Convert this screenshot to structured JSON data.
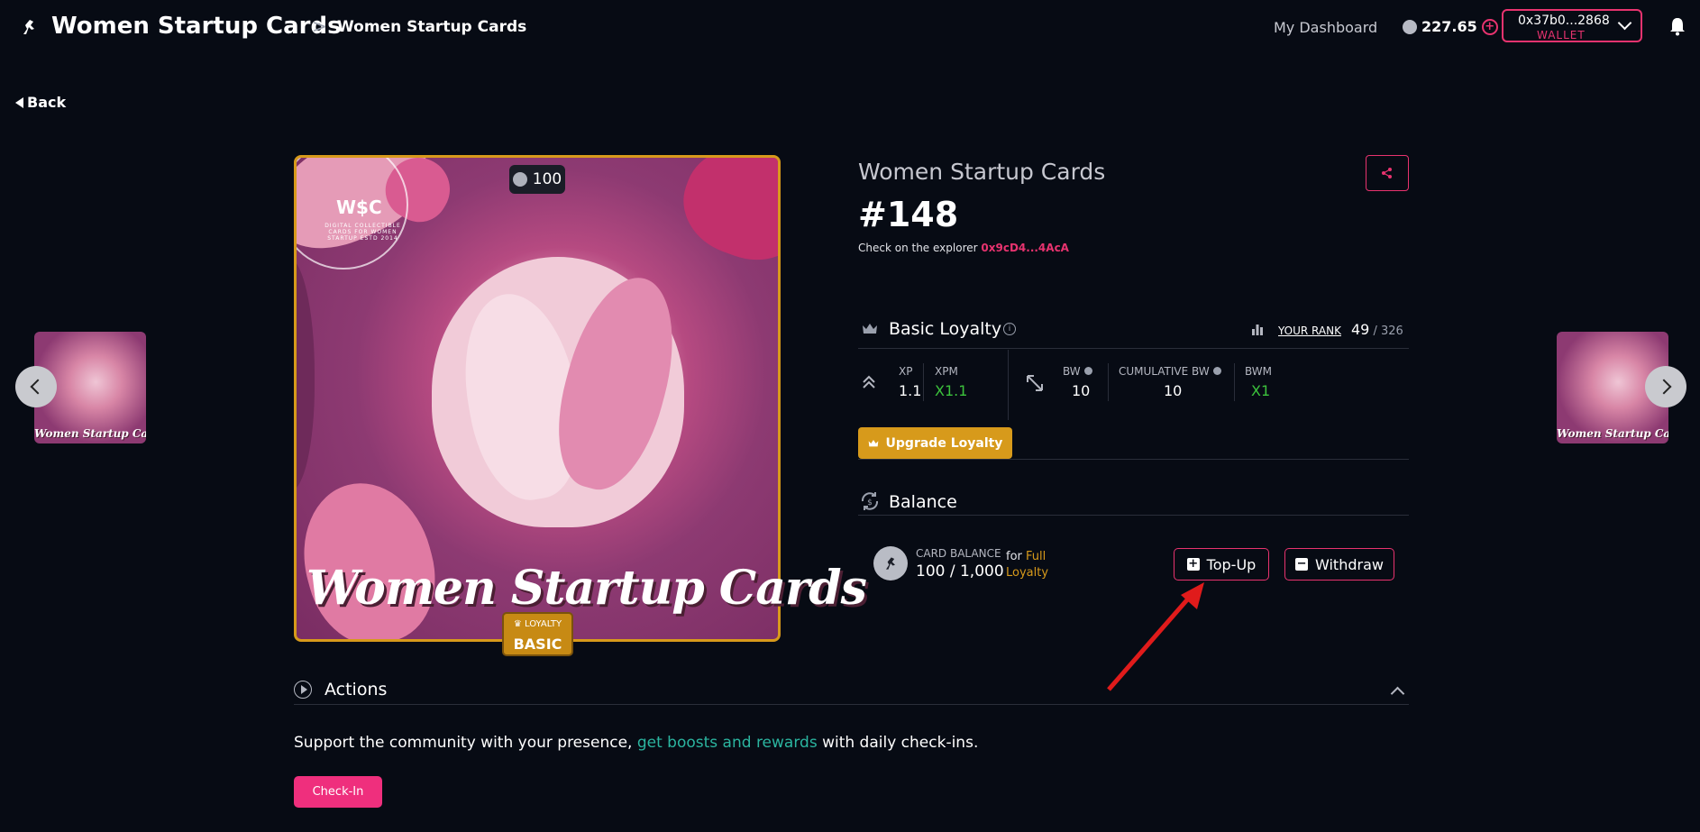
{
  "header": {
    "app_title": "Women Startup Cards",
    "breadcrumb_sep": ">",
    "breadcrumb": "Women Startup Cards",
    "nav_dashboard": "My Dashboard",
    "balance": "227.65",
    "wallet_address": "0x37b0...2868",
    "wallet_label": "WALLET"
  },
  "back_label": "Back",
  "card": {
    "count": "100",
    "logo_text": "W$C",
    "logo_sub": "DIGITAL COLLECTIBLE CARDS FOR WOMEN STARTUP ESTD 2014",
    "name_overlay": "Women Startup Cards",
    "loyalty_badge_top": "LOYALTY",
    "loyalty_badge_main": "BASIC",
    "thumb_text": "Women Startup Cards"
  },
  "details": {
    "title": "Women Startup Cards",
    "number": "#148",
    "explorer_prefix": "Check on the explorer",
    "explorer_link": "0x9cD4...4AcA"
  },
  "loyalty": {
    "title": "Basic Loyalty",
    "rank_label": "YOUR RANK",
    "rank": "49",
    "rank_total": " / 326",
    "stats": [
      {
        "label": "XP",
        "value": "1.1"
      },
      {
        "label": "XPM",
        "value": "X1.1"
      },
      {
        "label": "BW",
        "value": "10"
      },
      {
        "label": "CUMULATIVE BW",
        "value": "10"
      },
      {
        "label": "BWM",
        "value": "X1"
      }
    ],
    "upgrade_label": "Upgrade Loyalty"
  },
  "balance": {
    "title": "Balance",
    "card_balance_label": "CARD BALANCE",
    "card_balance_value": "100 / 1,000",
    "for_text": "for",
    "for_highlight_1": "Full",
    "for_highlight_2": "Loyalty",
    "topup_label": "Top-Up",
    "withdraw_label": "Withdraw"
  },
  "actions": {
    "title": "Actions",
    "support_pre": "Support the community with your presence, ",
    "support_link": "get boosts and rewards",
    "support_post": " with daily check-ins.",
    "checkin_label": "Check-In"
  },
  "colors": {
    "accent_pink": "#e8336f",
    "gold": "#d79a1b",
    "teal": "#2bb5a0",
    "background": "#070b14"
  }
}
